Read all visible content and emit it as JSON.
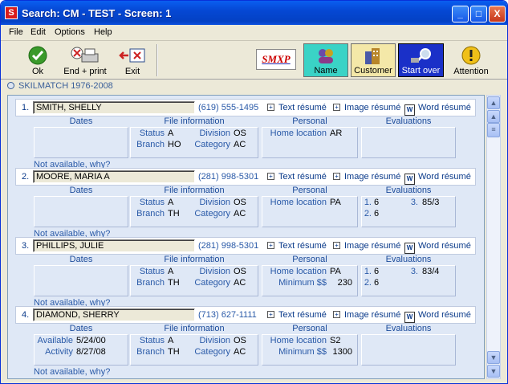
{
  "window": {
    "title": "Search: CM - TEST - Screen: 1",
    "minimize": "_",
    "maximize": "□",
    "close": "X"
  },
  "menu": [
    {
      "label": "File"
    },
    {
      "label": "Edit"
    },
    {
      "label": "Options"
    },
    {
      "label": "Help"
    }
  ],
  "toolbar": {
    "ok": "Ok",
    "end_print": "End + print",
    "exit": "Exit",
    "smxp": "SMXP",
    "name": "Name",
    "customer": "Customer",
    "start_over": "Start over",
    "attention": "Attention"
  },
  "brand_line": "SKILMATCH 1976-2008",
  "labels": {
    "dates": "Dates",
    "file_info": "File information",
    "personal": "Personal",
    "evaluations": "Evaluations",
    "status": "Status",
    "division": "Division",
    "branch": "Branch",
    "category": "Category",
    "home_location": "Home location",
    "minimum": "Minimum $$",
    "available": "Available",
    "activity": "Activity",
    "text_resume": "Text résumé",
    "image_resume": "Image résumé",
    "word_resume": "Word résumé",
    "not_available": "Not available, why?"
  },
  "records": [
    {
      "num": "1.",
      "name": "SMITH, SHELLY",
      "phone": "(619) 555-1495",
      "status": "A",
      "division": "OS",
      "branch": "HO",
      "category": "AC",
      "home_location": "AR",
      "minimum": "",
      "available": "",
      "activity": "",
      "evals": {
        "e1": "",
        "e2": "",
        "e3": ""
      }
    },
    {
      "num": "2.",
      "name": "MOORE, MARIA A",
      "phone": "(281) 998-5301",
      "status": "A",
      "division": "OS",
      "branch": "TH",
      "category": "AC",
      "home_location": "PA",
      "minimum": "",
      "available": "",
      "activity": "",
      "evals": {
        "e1": "6",
        "e2": "6",
        "e3": "85/3"
      }
    },
    {
      "num": "3.",
      "name": "PHILLIPS, JULIE",
      "phone": "(281) 998-5301",
      "status": "A",
      "division": "OS",
      "branch": "TH",
      "category": "AC",
      "home_location": "PA",
      "minimum": "230",
      "available": "",
      "activity": "",
      "evals": {
        "e1": "6",
        "e2": "6",
        "e3": "83/4"
      }
    },
    {
      "num": "4.",
      "name": "DIAMOND, SHERRY",
      "phone": "(713) 627-1111",
      "status": "A",
      "division": "OS",
      "branch": "TH",
      "category": "AC",
      "home_location": "S2",
      "minimum": "1300",
      "available": "5/24/00",
      "activity": "8/27/08",
      "evals": {
        "e1": "",
        "e2": "",
        "e3": ""
      }
    }
  ],
  "colors": {
    "titlebar": "#0548d4",
    "list_bg": "#dfe8f6",
    "link": "#2a5aa8"
  }
}
